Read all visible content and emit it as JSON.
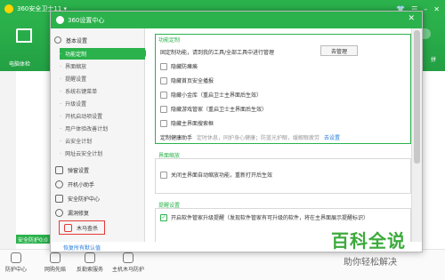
{
  "app": {
    "title": "360安全卫士11 ▾",
    "header_label": "电脑体检",
    "header_right": "拼",
    "safe_button": "安全防护0:0",
    "footer_items": [
      "防护中心",
      "网购先赔",
      "反勒索服务",
      "主机木马防护"
    ],
    "window_controls": [
      "👕",
      "☰",
      "–",
      "✕"
    ]
  },
  "dialog": {
    "title": "360设置中心",
    "close": "✕",
    "footer_link": "恢复所有默认值"
  },
  "sidebar": {
    "group": "基本设置",
    "subitems": [
      "功能定制",
      "界面缩放",
      "提醒设置",
      "系统右键菜单",
      "升级设置",
      "开机启动项设置",
      "用户体验改善计划",
      "云安全计划",
      "网址云安全计划"
    ],
    "items": [
      "弹窗设置",
      "开机小助手",
      "安全防护中心",
      "漏洞修复",
      "木马查杀"
    ]
  },
  "content": {
    "section1": {
      "title": "功能定制",
      "desc": "固定制功能，请到我的工具/全部工具中进行管理",
      "manage_btn": "去管理",
      "options": [
        "隐藏防瘫痪",
        "隐藏首页安全播报",
        "隐藏小金库（重启卫士主界面后生效）",
        "隐藏游戏管家（重启卫士主界面后生效）",
        "隐藏主界面搜索框"
      ],
      "helper_label": "定制健康助手",
      "helper_hint": "定时休息，同护身心健康；防蓝光护眼，缓解眼疲劳",
      "helper_link": "去设置"
    },
    "section2": {
      "title": "界面缩放",
      "option": "关闭主界面自动缩放功能，重新打开后生效"
    },
    "section3": {
      "title": "提醒设置",
      "option": "开启软件管家升级提醒（发现软件管家有可升级的软件，将在主界面展示提醒标识）"
    }
  },
  "watermark": {
    "big": "百科全说",
    "small": "助你轻松解决"
  },
  "colors": {
    "brand_green": "#2bb24c",
    "highlight_red": "#e53935",
    "link_blue": "#2a7ddb"
  }
}
